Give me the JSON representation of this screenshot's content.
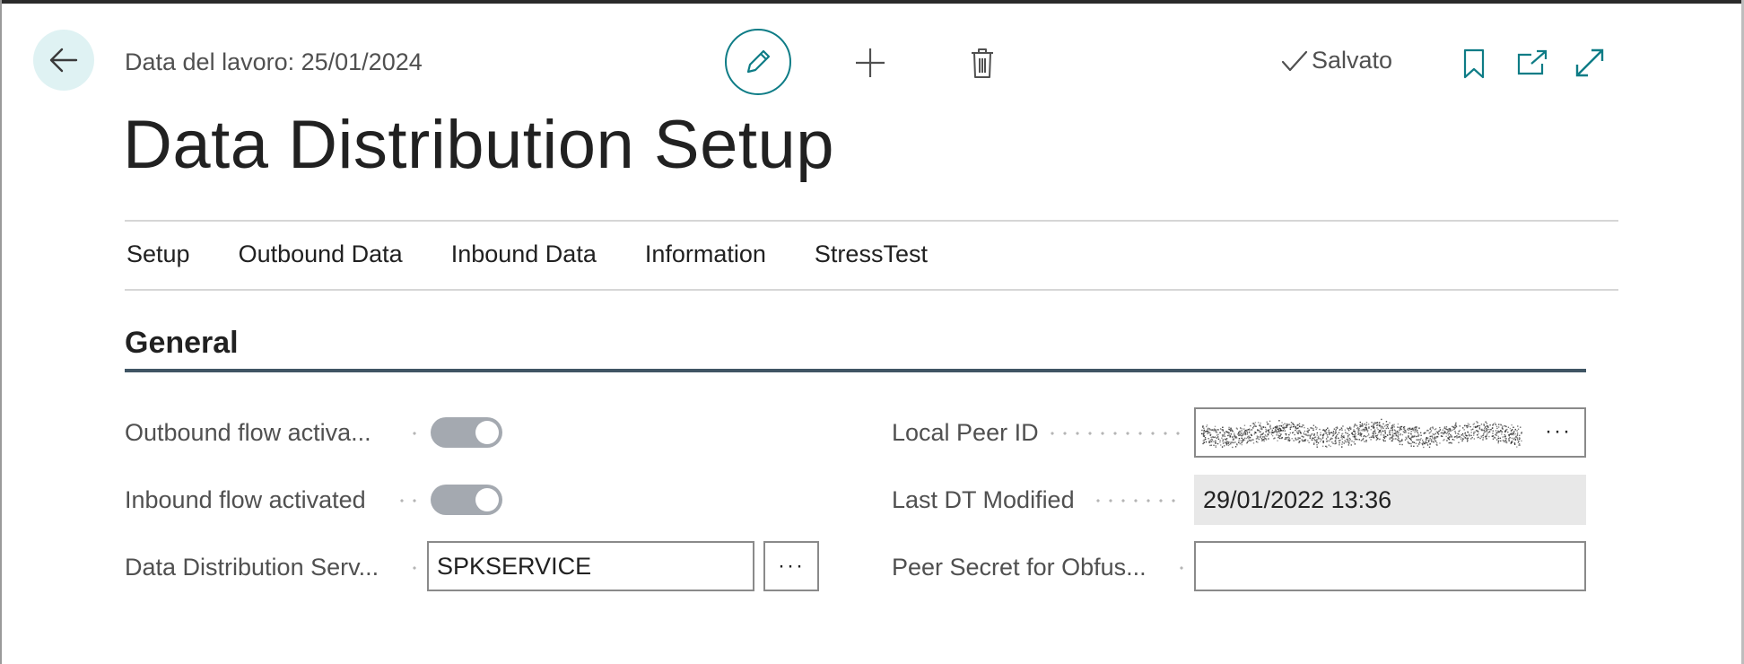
{
  "header": {
    "work_date": "Data del lavoro: 25/01/2024",
    "saved_label": "Salvato"
  },
  "page": {
    "title": "Data Distribution Setup"
  },
  "tabs": [
    {
      "label": "Setup"
    },
    {
      "label": "Outbound Data"
    },
    {
      "label": "Inbound Data"
    },
    {
      "label": "Information"
    },
    {
      "label": "StressTest"
    }
  ],
  "general": {
    "title": "General",
    "outbound_flow": {
      "label": "Outbound flow activa...",
      "value": true
    },
    "inbound_flow": {
      "label": "Inbound flow activated",
      "value": true
    },
    "dd_service": {
      "label": "Data Distribution Serv...",
      "value": "SPKSERVICE",
      "assist": "···"
    },
    "local_peer_id": {
      "label": "Local Peer ID",
      "assist": "···"
    },
    "last_dt_modified": {
      "label": "Last DT Modified",
      "value": "29/01/2022 13:36"
    },
    "peer_secret": {
      "label": "Peer Secret for Obfus...",
      "value": ""
    }
  },
  "colors": {
    "accent": "#0e7c86",
    "section_rule": "#405564",
    "toggle_on": "#a4a9b0"
  },
  "icons": {
    "back": "arrow-left-icon",
    "edit": "pencil-icon",
    "new": "plus-icon",
    "delete": "trash-icon",
    "saved": "checkmark-icon",
    "bookmark": "bookmark-icon",
    "open_new": "open-in-new-window-icon",
    "expand": "expand-icon"
  }
}
